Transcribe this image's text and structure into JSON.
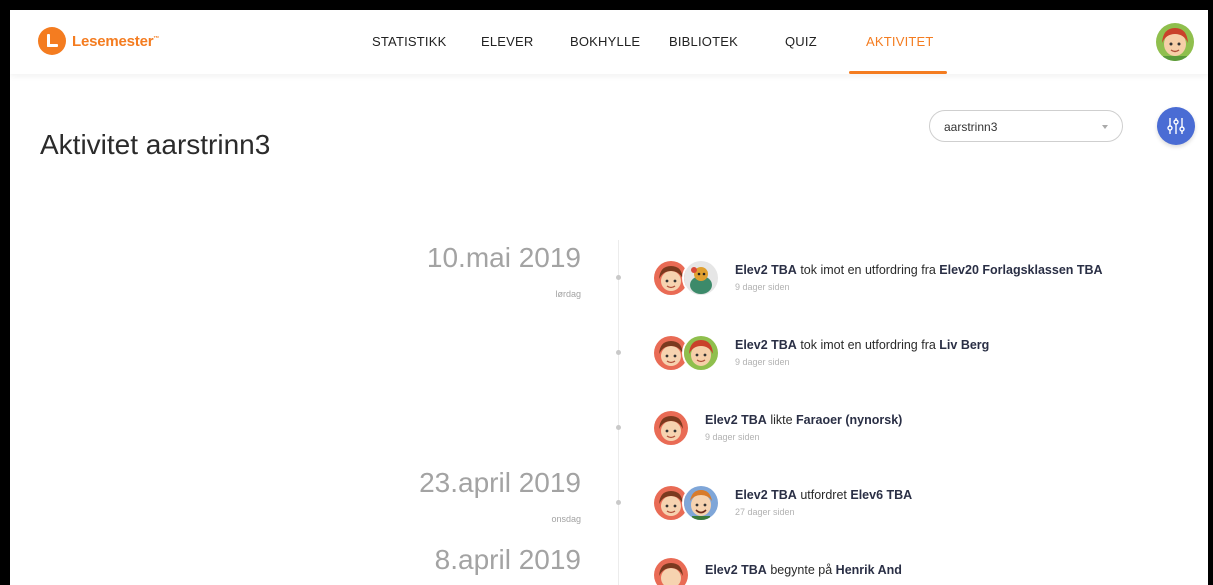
{
  "brand": {
    "name": "Lesemester",
    "tm": "™"
  },
  "nav": [
    {
      "label": "STATISTIKK",
      "active": false
    },
    {
      "label": "ELEVER",
      "active": false
    },
    {
      "label": "BOKHYLLE",
      "active": false
    },
    {
      "label": "BIBLIOTEK",
      "active": false
    },
    {
      "label": "QUIZ",
      "active": false
    },
    {
      "label": "AKTIVITET",
      "active": true
    }
  ],
  "page": {
    "title": "Aktivitet aarstrinn3"
  },
  "filter": {
    "selected": "aarstrinn3",
    "icon": "sliders-icon"
  },
  "colors": {
    "accent": "#f47c20",
    "button": "#4a6cd4"
  },
  "dates": [
    {
      "date": "10.mai 2019",
      "weekday": "lørdag"
    },
    {
      "date": "23.april 2019",
      "weekday": "onsdag"
    },
    {
      "date": "8.april 2019",
      "weekday": ""
    }
  ],
  "activities": [
    {
      "actor": "Elev2 TBA",
      "verb": "tok imot en utfordring fra",
      "object": "Elev20 Forlagsklassen TBA",
      "time": "9 dager siden"
    },
    {
      "actor": "Elev2 TBA",
      "verb": "tok imot en utfordring fra",
      "object": "Liv Berg",
      "time": "9 dager siden"
    },
    {
      "actor": "Elev2 TBA",
      "verb": "likte",
      "object": "Faraoer (nynorsk)",
      "time": "9 dager siden"
    },
    {
      "actor": "Elev2 TBA",
      "verb": "utfordret",
      "object": "Elev6 TBA",
      "time": "27 dager siden"
    },
    {
      "actor": "Elev2 TBA",
      "verb": "begynte på",
      "object": "Henrik And",
      "time": ""
    }
  ]
}
